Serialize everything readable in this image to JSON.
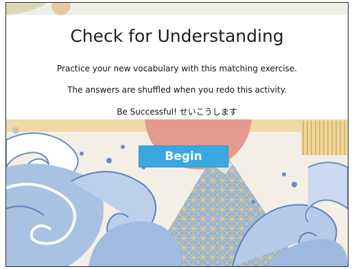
{
  "activity": {
    "title": "Check for Understanding",
    "instructions": [
      "Practice your new vocabulary with this matching exercise.",
      "The answers are shuffled when you redo this activity.",
      "Be Successful! せいこうします"
    ],
    "begin_label": "Begin"
  },
  "colors": {
    "wave_blue": "#9fb9de",
    "wave_dark": "#5c7fbd",
    "sun_red": "#e49a8f",
    "gold": "#e6c57a",
    "mountain_blue": "#7aa3d6",
    "button_blue": "#3aa8e0"
  },
  "illustration": {
    "icon": "great-wave-mount-fuji-illustration"
  }
}
